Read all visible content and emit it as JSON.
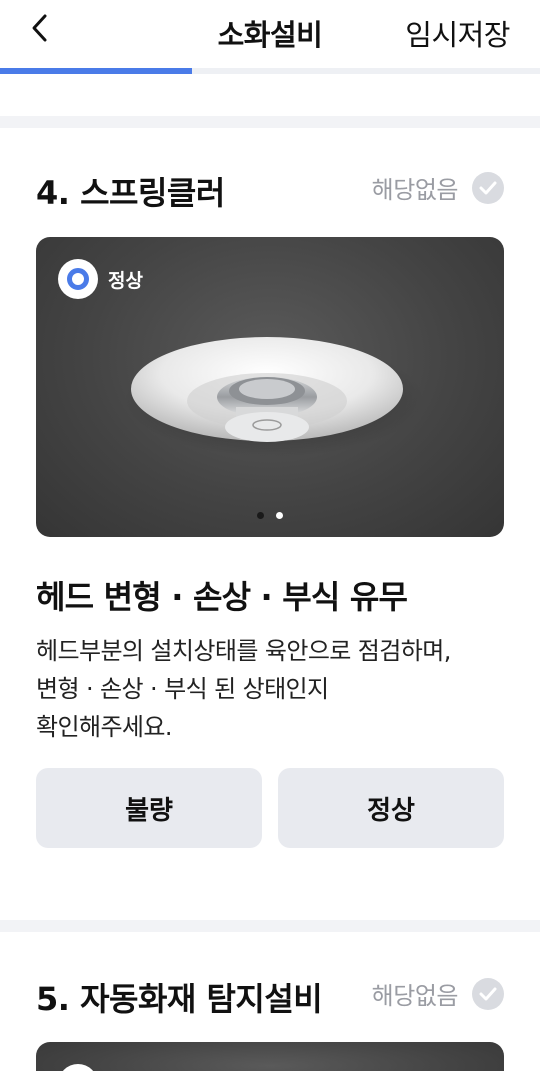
{
  "header": {
    "back_icon": "chevron-left-icon",
    "title": "소화설비",
    "save_label": "임시저장"
  },
  "progress": {
    "fraction": 0.355
  },
  "sections": [
    {
      "title": "4. 스프링클러",
      "na_label": "해당없음",
      "photo": {
        "status_label": "정상",
        "slide_count": 2,
        "active_slide": 2
      },
      "check_title": "헤드 변형 · 손상 · 부식 유무",
      "check_desc_lines": [
        "헤드부분의 설치상태를 육안으로 점검하며,",
        "변형 · 손상 · 부식 된 상태인지",
        "확인해주세요."
      ],
      "buttons": {
        "bad": "불량",
        "good": "정상"
      }
    },
    {
      "title": "5. 자동화재 탐지설비",
      "na_label": "해당없음"
    }
  ],
  "colors": {
    "accent": "#4a7be8",
    "button_bg": "#e8eaef",
    "muted": "#9a9ca3"
  }
}
